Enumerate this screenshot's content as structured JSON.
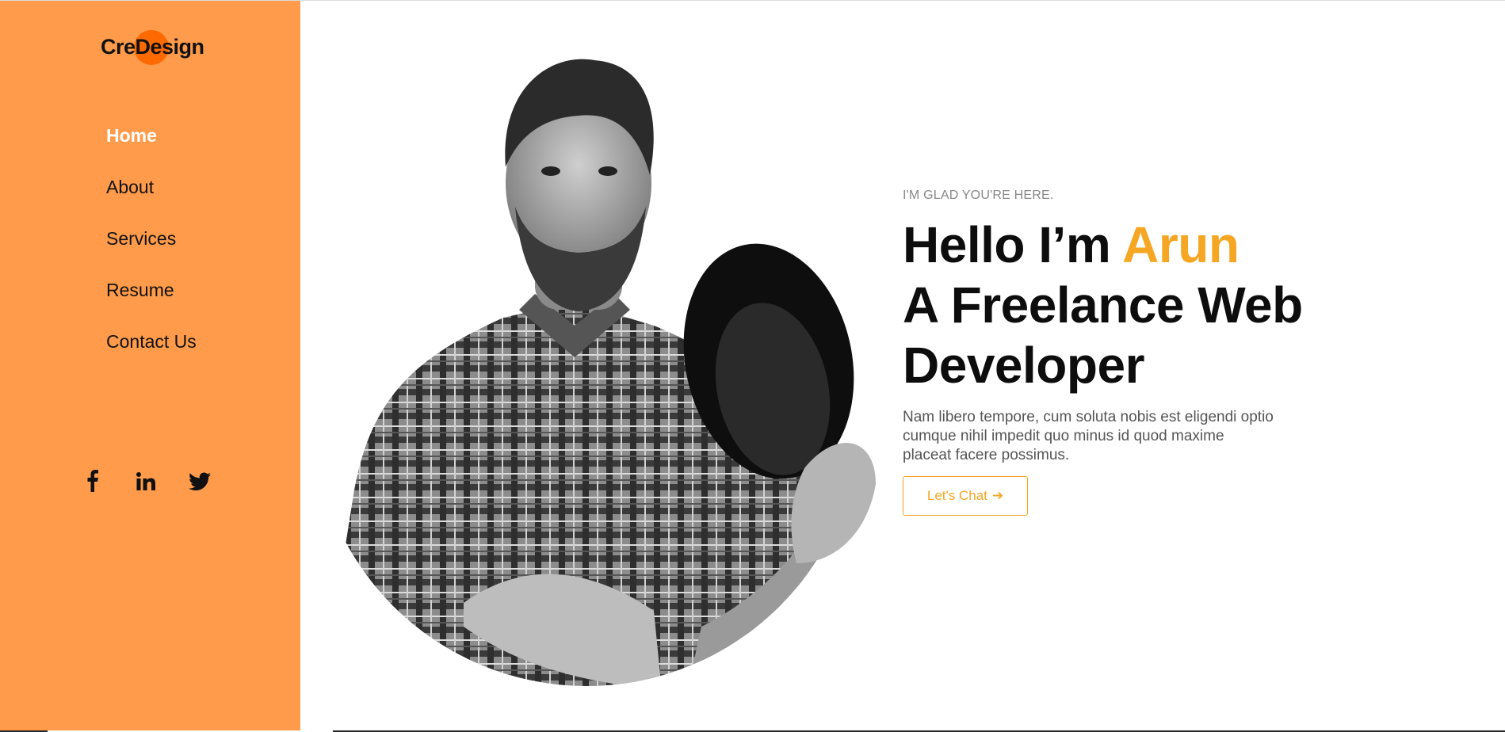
{
  "brand": {
    "logo_text": "CreDesign",
    "accent_color": "#ff9b4a",
    "logo_dot_color": "#ff6a00",
    "highlight_color": "#f5a623"
  },
  "sidebar": {
    "nav": [
      {
        "label": "Home",
        "active": true
      },
      {
        "label": "About",
        "active": false
      },
      {
        "label": "Services",
        "active": false
      },
      {
        "label": "Resume",
        "active": false
      },
      {
        "label": "Contact Us",
        "active": false
      }
    ],
    "social": [
      {
        "icon": "facebook-icon"
      },
      {
        "icon": "linkedin-icon"
      },
      {
        "icon": "twitter-icon"
      }
    ]
  },
  "hero": {
    "eyebrow": "I'M GLAD YOU'RE HERE.",
    "greeting": "Hello I’m ",
    "name": "Arun",
    "line2": "A Freelance Web",
    "line3": "Developer",
    "description": "Nam libero tempore, cum soluta nobis est eligendi optio cumque nihil impedit quo minus id quod maxime placeat facere possimus.",
    "cta_label": "Let's Chat",
    "cta_arrow": "➔"
  },
  "portrait": {
    "icon": "portrait-photo"
  }
}
